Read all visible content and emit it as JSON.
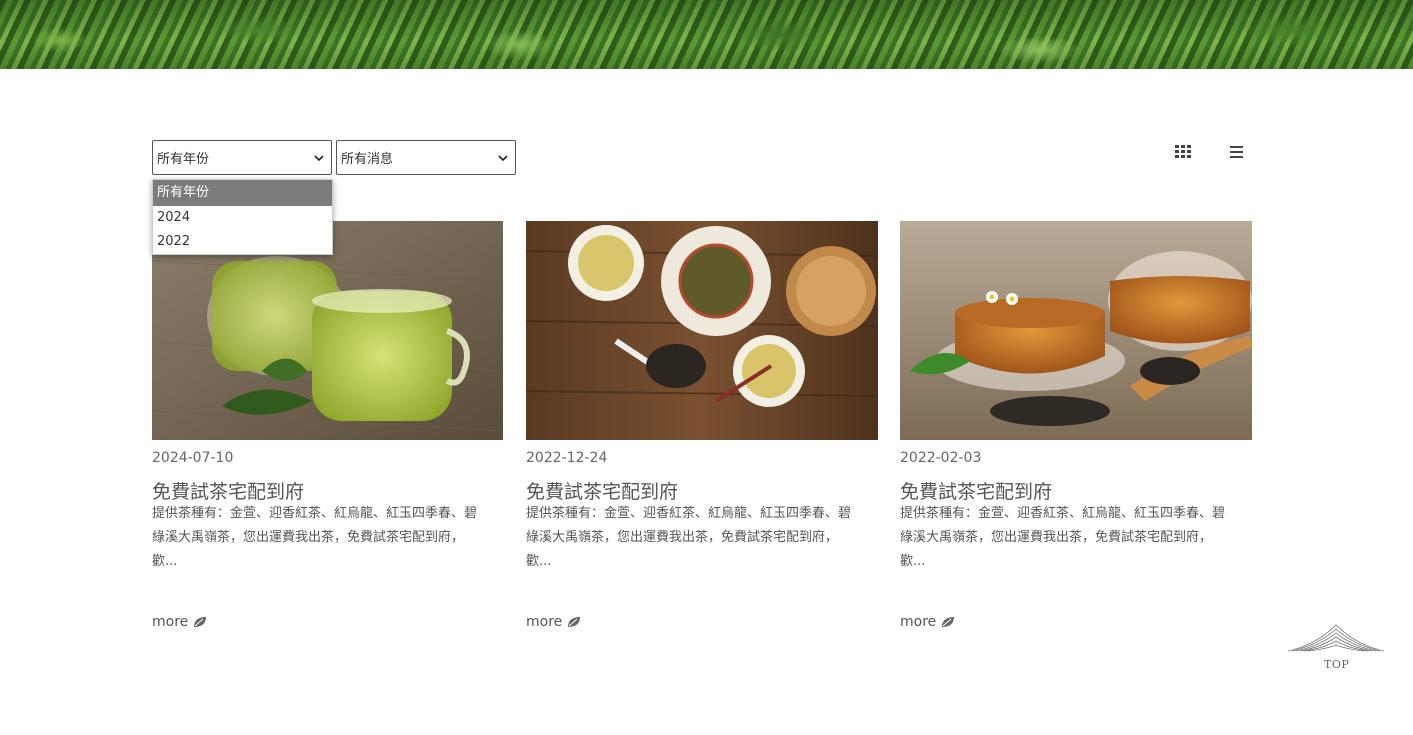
{
  "filters": {
    "year": {
      "selected": "所有年份",
      "options": [
        "所有年份",
        "2024",
        "2022"
      ]
    },
    "category": {
      "selected": "所有消息"
    }
  },
  "view_toggles": {
    "grid_icon": "grid-view-icon",
    "list_icon": "list-view-icon"
  },
  "posts": [
    {
      "date": "2024-07-10",
      "title": "免費試茶宅配到府",
      "desc_lines": [
        "提供茶種有：金萱、迎香紅茶、紅烏龍、紅玉四季春、碧",
        "綠溪大禹嶺茶，您出運費我出茶，免費試茶宅配到府，",
        "歡..."
      ],
      "more": "more"
    },
    {
      "date": "2022-12-24",
      "title": "免費試茶宅配到府",
      "desc_lines": [
        "提供茶種有：金萱、迎香紅茶、紅烏龍、紅玉四季春、碧",
        "綠溪大禹嶺茶，您出運費我出茶，免費試茶宅配到府，",
        "歡..."
      ],
      "more": "more"
    },
    {
      "date": "2022-02-03",
      "title": "免費試茶宅配到府",
      "desc_lines": [
        "提供茶種有：金萱、迎香紅茶、紅烏龍、紅玉四季春、碧",
        "綠溪大禹嶺茶，您出運費我出茶，免費試茶宅配到府，",
        "歡..."
      ],
      "more": "more"
    }
  ],
  "back_to_top": "TOP",
  "colors": {
    "accent": "#7c7c7c",
    "text": "#555555"
  }
}
